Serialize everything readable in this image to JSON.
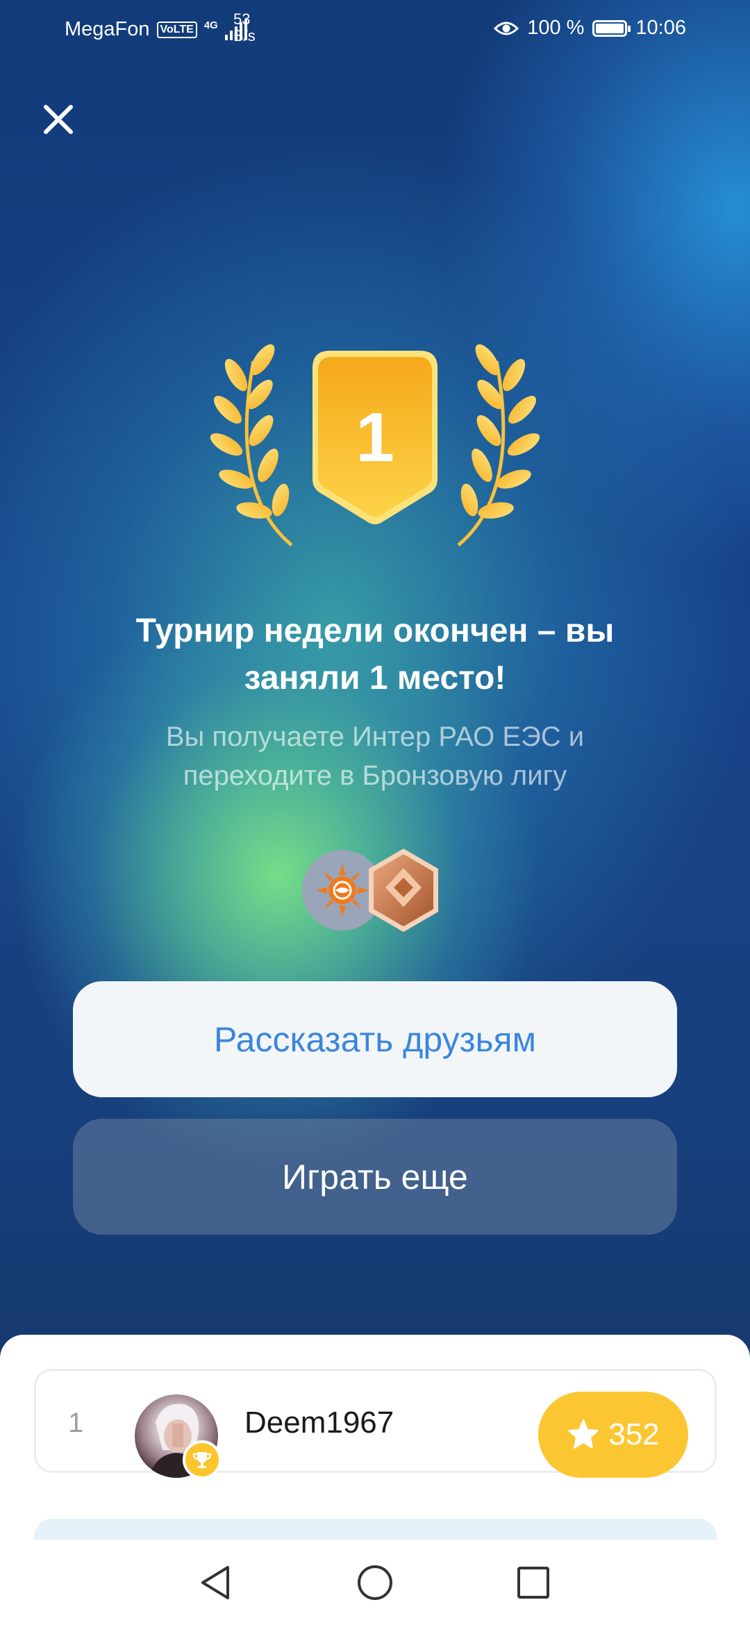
{
  "status_bar": {
    "carrier": "MegaFon",
    "volte": "VoLTE",
    "network": "4G",
    "speed_value": "53",
    "speed_unit": "B/s",
    "battery": "100 %",
    "time": "10:06"
  },
  "result": {
    "place_number": "1",
    "title_line1": "Турнир недели окончен – вы",
    "title_line2": "заняли 1 место!",
    "subtitle_line1": "Вы получаете Интер РАО ЕЭС и",
    "subtitle_line2": "переходите в Бронзовую лигу"
  },
  "actions": {
    "share_label": "Рассказать друзьям",
    "play_label": "Играть еще"
  },
  "leaderboard": {
    "rows": [
      {
        "rank": "1",
        "username": "Deem1967",
        "score": "352"
      }
    ]
  },
  "colors": {
    "accent_blue": "#3b86dd",
    "gold": "#fcc633",
    "bronze": "#c8794a"
  },
  "icons": {
    "close": "close-icon",
    "laurel": "laurel-icon",
    "company": "inter-rao-logo",
    "league": "bronze-league-icon",
    "trophy_badge": "trophy-icon",
    "star": "star-icon"
  }
}
